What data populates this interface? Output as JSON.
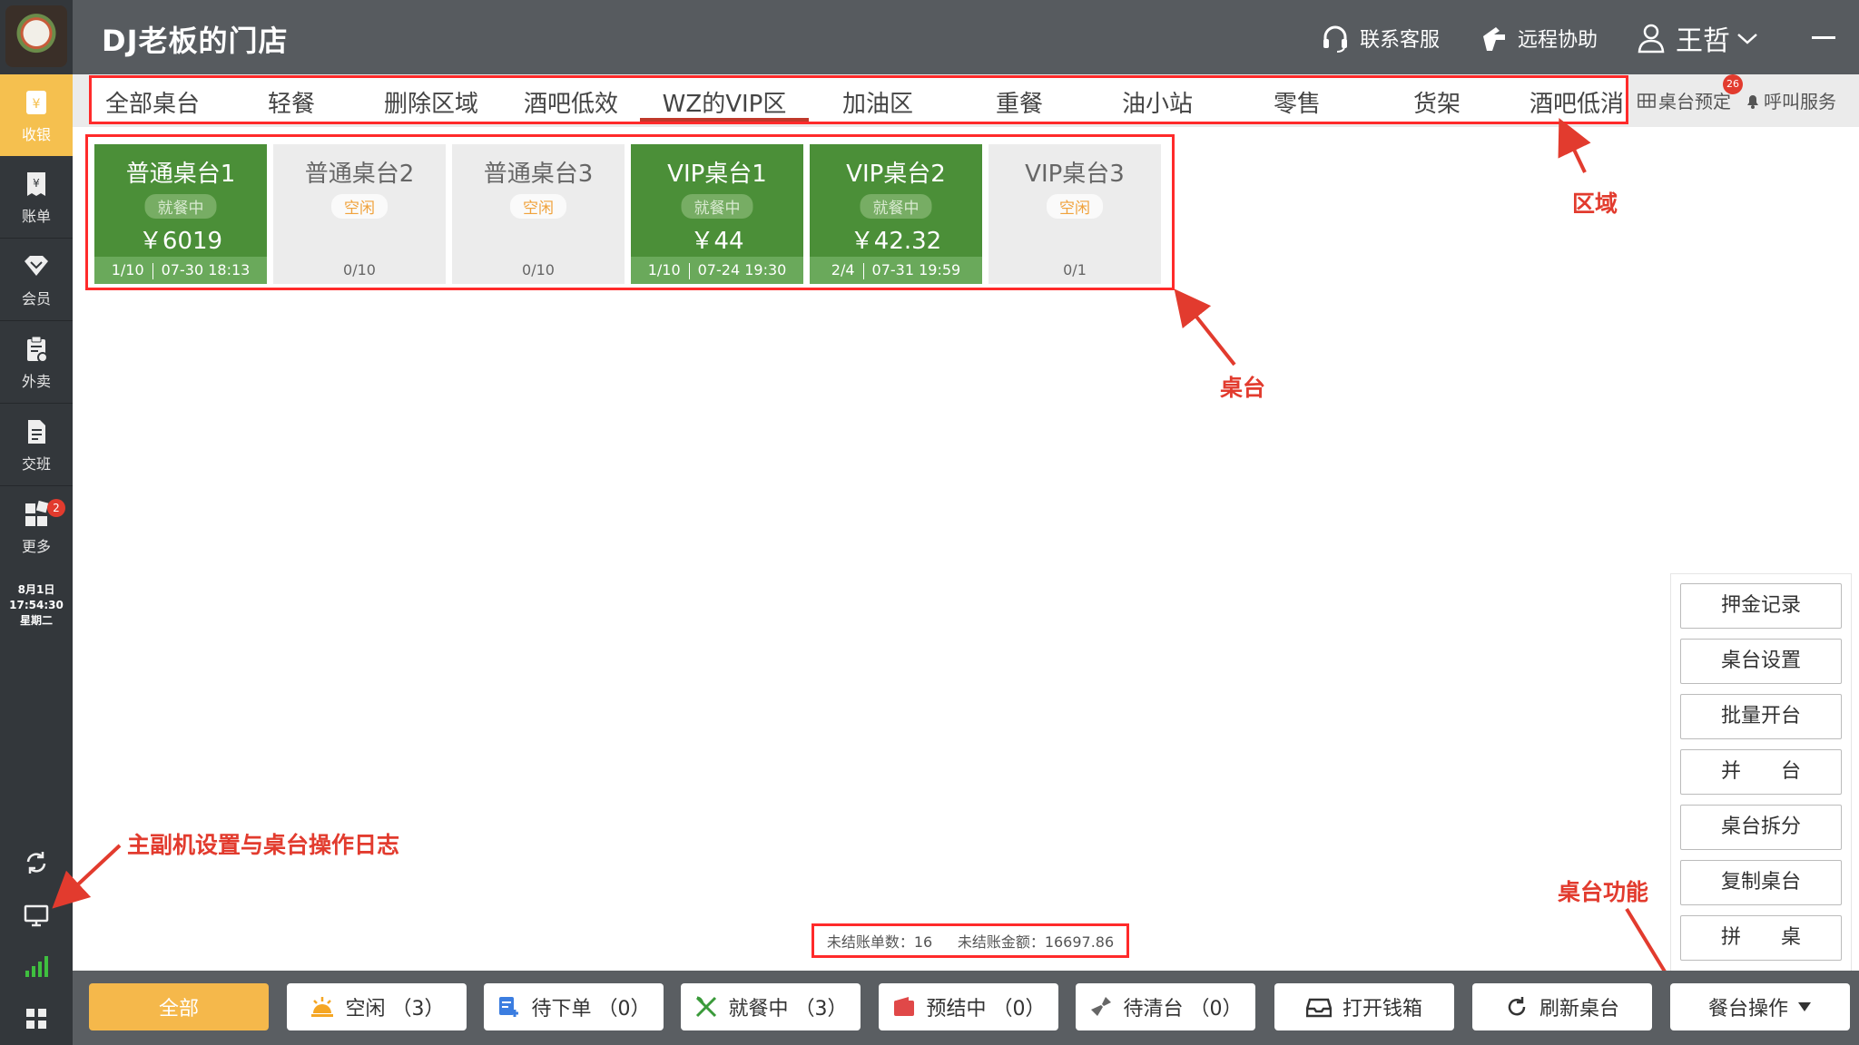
{
  "sidebar": {
    "items": [
      {
        "label": "收银",
        "icon": "cashier-icon"
      },
      {
        "label": "账单",
        "icon": "bill-icon"
      },
      {
        "label": "会员",
        "icon": "member-icon"
      },
      {
        "label": "外卖",
        "icon": "takeout-icon"
      },
      {
        "label": "交班",
        "icon": "handover-icon"
      },
      {
        "label": "更多",
        "icon": "more-icon",
        "badge": "2"
      }
    ],
    "datetime": {
      "date": "8月1日",
      "time": "17:54:30",
      "weekday": "星期二"
    }
  },
  "header": {
    "title": "DJ老板的门店",
    "support": "联系客服",
    "remote": "远程协助",
    "user": "王哲"
  },
  "tabs": [
    "全部桌台",
    "轻餐",
    "删除区域",
    "酒吧低效",
    "WZ的VIP区",
    "加油区",
    "重餐",
    "油小站",
    "零售",
    "货架",
    "酒吧低消"
  ],
  "active_tab": "WZ的VIP区",
  "tab_extra": {
    "reserve": "桌台预定",
    "reserve_badge": "26",
    "call": "呼叫服务"
  },
  "tables": [
    {
      "name": "普通桌台1",
      "status": "就餐中",
      "amount": "￥6019",
      "seats": "1/10",
      "time": "07-30 18:13",
      "busy": true
    },
    {
      "name": "普通桌台2",
      "status": "空闲",
      "amount": "",
      "seats": "0/10",
      "time": "",
      "busy": false
    },
    {
      "name": "普通桌台3",
      "status": "空闲",
      "amount": "",
      "seats": "0/10",
      "time": "",
      "busy": false
    },
    {
      "name": "VIP桌台1",
      "status": "就餐中",
      "amount": "￥44",
      "seats": "1/10",
      "time": "07-24 19:30",
      "busy": true
    },
    {
      "name": "VIP桌台2",
      "status": "就餐中",
      "amount": "￥42.32",
      "seats": "2/4",
      "time": "07-31 19:59",
      "busy": true
    },
    {
      "name": "VIP桌台3",
      "status": "空闲",
      "amount": "",
      "seats": "0/1",
      "time": "",
      "busy": false
    }
  ],
  "annotations": {
    "area": "区域",
    "table": "桌台",
    "log": "主副机设置与桌台操作日志",
    "func": "桌台功能"
  },
  "actions": [
    "押金记录",
    "桌台设置",
    "批量开台",
    "并　　台",
    "桌台拆分",
    "复制桌台",
    "拼　　桌"
  ],
  "summary": {
    "unsettled_count": "未结账单数：16",
    "unsettled_amount": "未结账金额：16697.86"
  },
  "bottom": {
    "all": "全部",
    "idle": "空闲 （3）",
    "pending": "待下单 （0）",
    "dining": "就餐中 （3）",
    "prebill": "预结中 （0）",
    "cleaning": "待清台 （0）",
    "cashbox": "打开钱箱",
    "refresh": "刷新桌台",
    "ops": "餐台操作"
  },
  "colors": {
    "accent": "#f5b84b",
    "busy": "#4b8f38",
    "annotation": "#e23b2e"
  }
}
